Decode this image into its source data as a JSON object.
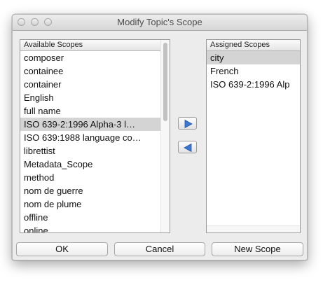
{
  "window": {
    "title": "Modify Topic's Scope"
  },
  "available": {
    "header": "Available Scopes",
    "items": [
      "composer",
      "containee",
      "container",
      "English",
      "full name",
      "ISO 639-2:1996 Alpha-3 l…",
      "ISO 639:1988 language co…",
      "librettist",
      "Metadata_Scope",
      "method",
      "nom de guerre",
      "nom de plume",
      "offline",
      "online"
    ],
    "selected_index": 5
  },
  "assigned": {
    "header": "Assigned Scopes",
    "items": [
      "city",
      "French",
      "ISO 639-2:1996 Alp"
    ],
    "selected_index": 0
  },
  "buttons": {
    "add_icon": "right-arrow-icon",
    "remove_icon": "left-arrow-icon",
    "ok": "OK",
    "cancel": "Cancel",
    "new_scope": "New Scope"
  },
  "colors": {
    "arrow_blue": "#3a78d4",
    "selection_gray": "#d4d4d4"
  }
}
